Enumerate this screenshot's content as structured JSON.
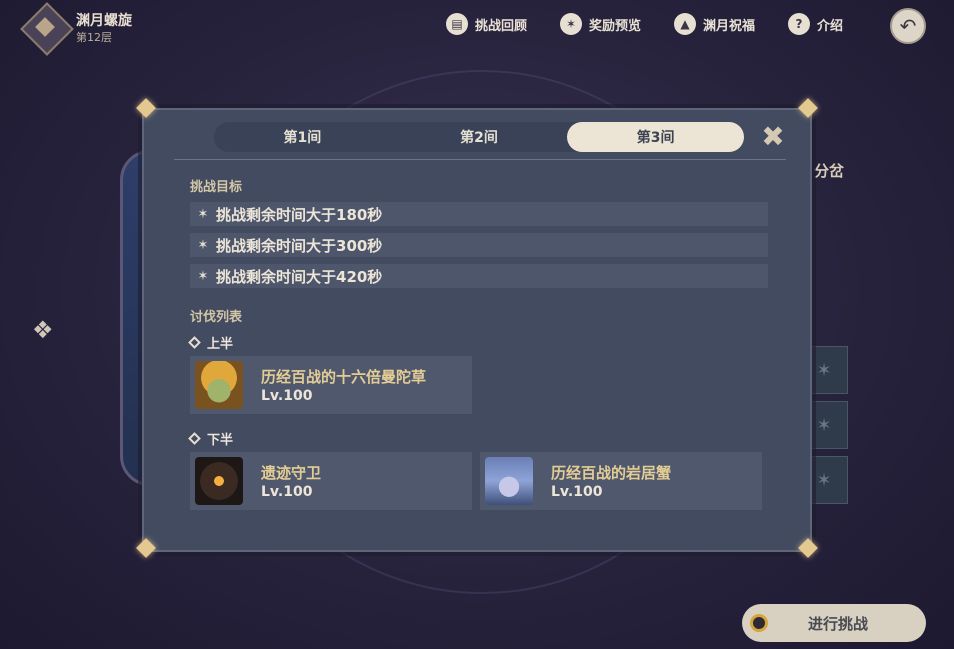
{
  "header": {
    "mode_title": "渊月螺旋",
    "floor": "第12层",
    "nav": [
      {
        "label": "挑战回顾",
        "icon": "book-icon"
      },
      {
        "label": "奖励预览",
        "icon": "star-badge-icon"
      },
      {
        "label": "渊月祝福",
        "icon": "upload-arrow-icon"
      },
      {
        "label": "介绍",
        "icon": "help-icon"
      }
    ]
  },
  "background": {
    "side_label": "分岔"
  },
  "dialog": {
    "tabs": [
      "第1间",
      "第2间",
      "第3间"
    ],
    "active_tab": 2,
    "objectives_title": "挑战目标",
    "objectives": [
      "挑战剩余时间大于180秒",
      "挑战剩余时间大于300秒",
      "挑战剩余时间大于420秒"
    ],
    "enemy_list_title": "讨伐列表",
    "first_half": {
      "label": "上半",
      "enemies": [
        {
          "name": "历经百战的十六倍曼陀草",
          "level": "Lv.100"
        }
      ]
    },
    "second_half": {
      "label": "下半",
      "enemies": [
        {
          "name": "遗迹守卫",
          "level": "Lv.100"
        },
        {
          "name": "历经百战的岩居蟹",
          "level": "Lv.100"
        }
      ]
    }
  },
  "start_button": {
    "label": "进行挑战"
  },
  "colors": {
    "accent_gold": "#e3cd95",
    "dialog_bg": "#434b60",
    "active_tab": "#ece5d6"
  }
}
